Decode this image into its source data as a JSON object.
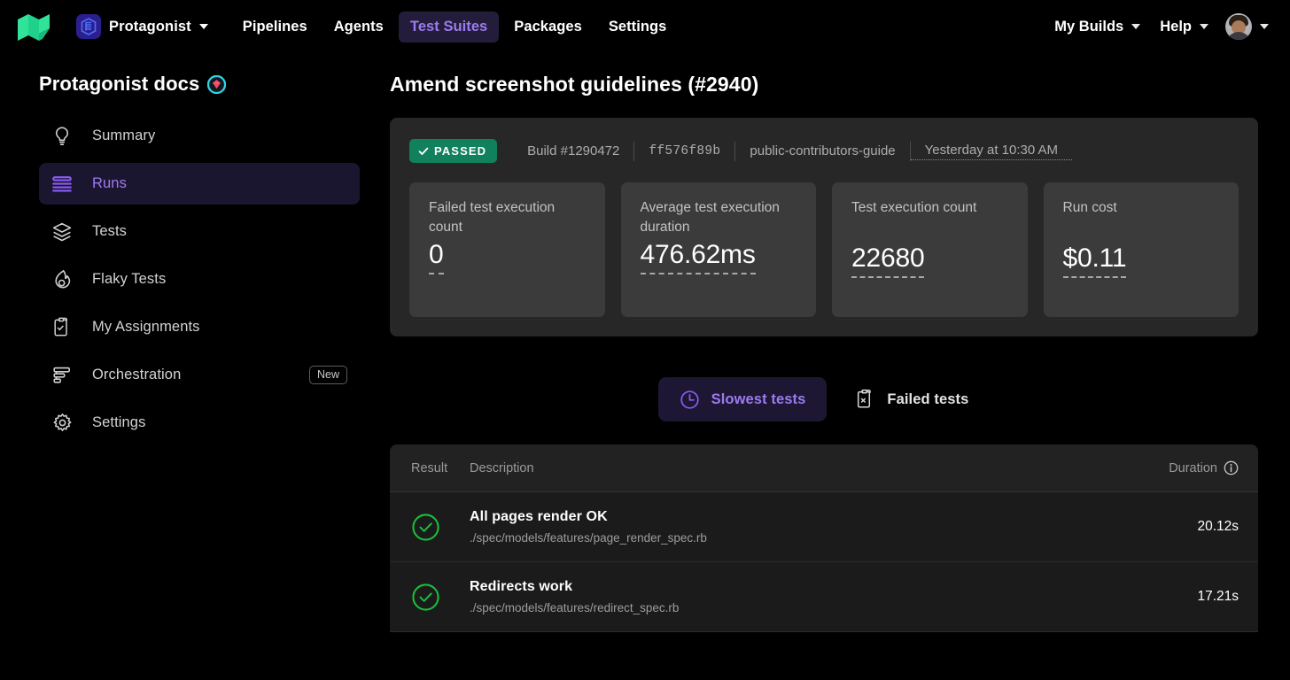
{
  "topnav": {
    "logo_icon": "buildkite-logo",
    "logo_color": "#30e398",
    "org": {
      "icon": "protagonist-badge-icon",
      "name": "Protagonist",
      "caret_icon": "chevron-down-icon"
    },
    "links": [
      {
        "label": "Pipelines",
        "active": false
      },
      {
        "label": "Agents",
        "active": false
      },
      {
        "label": "Test Suites",
        "active": true
      },
      {
        "label": "Packages",
        "active": false
      },
      {
        "label": "Settings",
        "active": false
      }
    ],
    "right": {
      "my_builds": "My Builds",
      "help": "Help",
      "avatar_icon": "user-avatar",
      "caret_icon": "chevron-down-icon"
    },
    "active_color": "#9c7bf0"
  },
  "sidebar": {
    "title": "Protagonist docs",
    "title_badge_icon": "ruby-gem-icon",
    "items": [
      {
        "label": "Summary",
        "icon": "lightbulb-icon",
        "active": false,
        "badge": ""
      },
      {
        "label": "Runs",
        "icon": "runs-bars-icon",
        "active": true,
        "badge": ""
      },
      {
        "label": "Tests",
        "icon": "layers-icon",
        "active": false,
        "badge": ""
      },
      {
        "label": "Flaky Tests",
        "icon": "flame-icon",
        "active": false,
        "badge": ""
      },
      {
        "label": "My Assignments",
        "icon": "clipboard-check-icon",
        "active": false,
        "badge": ""
      },
      {
        "label": "Orchestration",
        "icon": "funnel-bars-icon",
        "active": false,
        "badge": "New"
      },
      {
        "label": "Settings",
        "icon": "gear-icon",
        "active": false,
        "badge": ""
      }
    ]
  },
  "main": {
    "page_title": "Amend screenshot guidelines (#2940)",
    "run_meta": {
      "status_badge": "PASSED",
      "status_check_icon": "check-icon",
      "status_color": "#11805c",
      "build": "Build #1290472",
      "commit": "ff576f89b",
      "branch": "public-contributors-guide",
      "timestamp": "Yesterday at 10:30 AM"
    },
    "stats": [
      {
        "label": "Failed test execution count",
        "value": "0"
      },
      {
        "label": "Average test execution duration",
        "value": "476.62ms"
      },
      {
        "label": "Test execution count",
        "value": "22680"
      },
      {
        "label": "Run cost",
        "value": "$0.11"
      }
    ],
    "tabs": [
      {
        "label": "Slowest tests",
        "icon": "clock-icon",
        "active": true
      },
      {
        "label": "Failed tests",
        "icon": "clipboard-x-icon",
        "active": false
      }
    ],
    "table": {
      "columns": {
        "result": "Result",
        "description": "Description",
        "duration": "Duration",
        "duration_info_icon": "info-icon"
      },
      "rows": [
        {
          "result_icon": "check-circle-icon",
          "name": "All pages render OK",
          "path": "./spec/models/features/page_render_spec.rb",
          "duration": "20.12s"
        },
        {
          "result_icon": "check-circle-icon",
          "name": "Redirects work",
          "path": "./spec/models/features/redirect_spec.rb",
          "duration": "17.21s"
        }
      ]
    }
  }
}
